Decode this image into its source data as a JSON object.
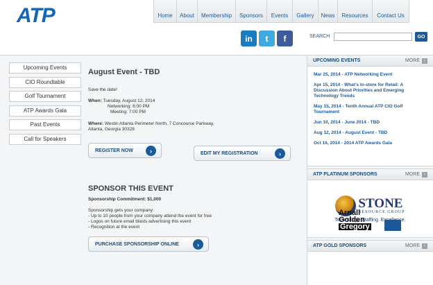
{
  "header": {
    "logo": "ATP",
    "nav": [
      "Home",
      "About",
      "Membership",
      "Sponsors",
      "Events",
      "Gallery",
      "News",
      "Resources",
      "Contact Us"
    ],
    "social": [
      {
        "icon": "linkedin-icon",
        "glyph": "in"
      },
      {
        "icon": "twitter-icon",
        "glyph": "t"
      },
      {
        "icon": "facebook-icon",
        "glyph": "f"
      }
    ],
    "search_label": "SEARCH",
    "search_value": "",
    "go_label": "GO"
  },
  "leftnav": [
    "Upcoming Events",
    "CIO Roundtable",
    "Golf Tournament",
    "ATP Awards Gala",
    "Past Events",
    "Call for Speakers"
  ],
  "event": {
    "title": "August Event - TBD",
    "save": "Save the date!",
    "when_label": "When:",
    "when_date": "Tuesday, August 12, 2014",
    "networking": "Networking: 6:00 PM",
    "meeting": "Meeting: 7:00 PM",
    "where_label": "Where:",
    "where_line1": "Westin Atlanta Perimeter North, 7 Concourse Parkway,",
    "where_line2": "Atlanta, Georgia 30328",
    "register": "REGISTER NOW",
    "edit": "EDIT MY REGISTRATION"
  },
  "sponsor": {
    "title": "SPONSOR THIS EVENT",
    "commitment_label": "Sponsorship Commitment:",
    "commitment_value": "$1,000",
    "gets": "Sponsorship gets your company:",
    "items": [
      "- Up to 10 people from your company attend the event for free",
      "- Logos on future email blasts advertising this event",
      "- Recognition at the event"
    ],
    "purchase": "PURCHASE SPONSORSHIP ONLINE"
  },
  "right": {
    "upcoming_head": "UPCOMING EVENTS",
    "more": "MORE",
    "events": [
      "Mar 25, 2014 - ATP Networking Event",
      "Apr 15, 2014 - What's In-store for Retail: A Discussion About Priorities and Emerging Technology Trends",
      "May 15, 2014 - Tenth Annual ATP CIO Golf Tournament",
      "Jun 10, 2014 - June 2014 - TBD",
      "Aug 12, 2014 - August Event - TBD",
      "Oct 16, 2014 - 2014 ATP Awards Gala"
    ],
    "platinum_head": "ATP PLATINUM SPONSORS",
    "stone_name": "STONE",
    "stone_sub": "RESOURCE GROUP",
    "stone_tag": "Technology. Staffing. Excellence.",
    "gold_head": "ATP GOLD SPONSORS",
    "gold_logo": [
      "Arnall",
      "Golden",
      "Gregory"
    ]
  }
}
